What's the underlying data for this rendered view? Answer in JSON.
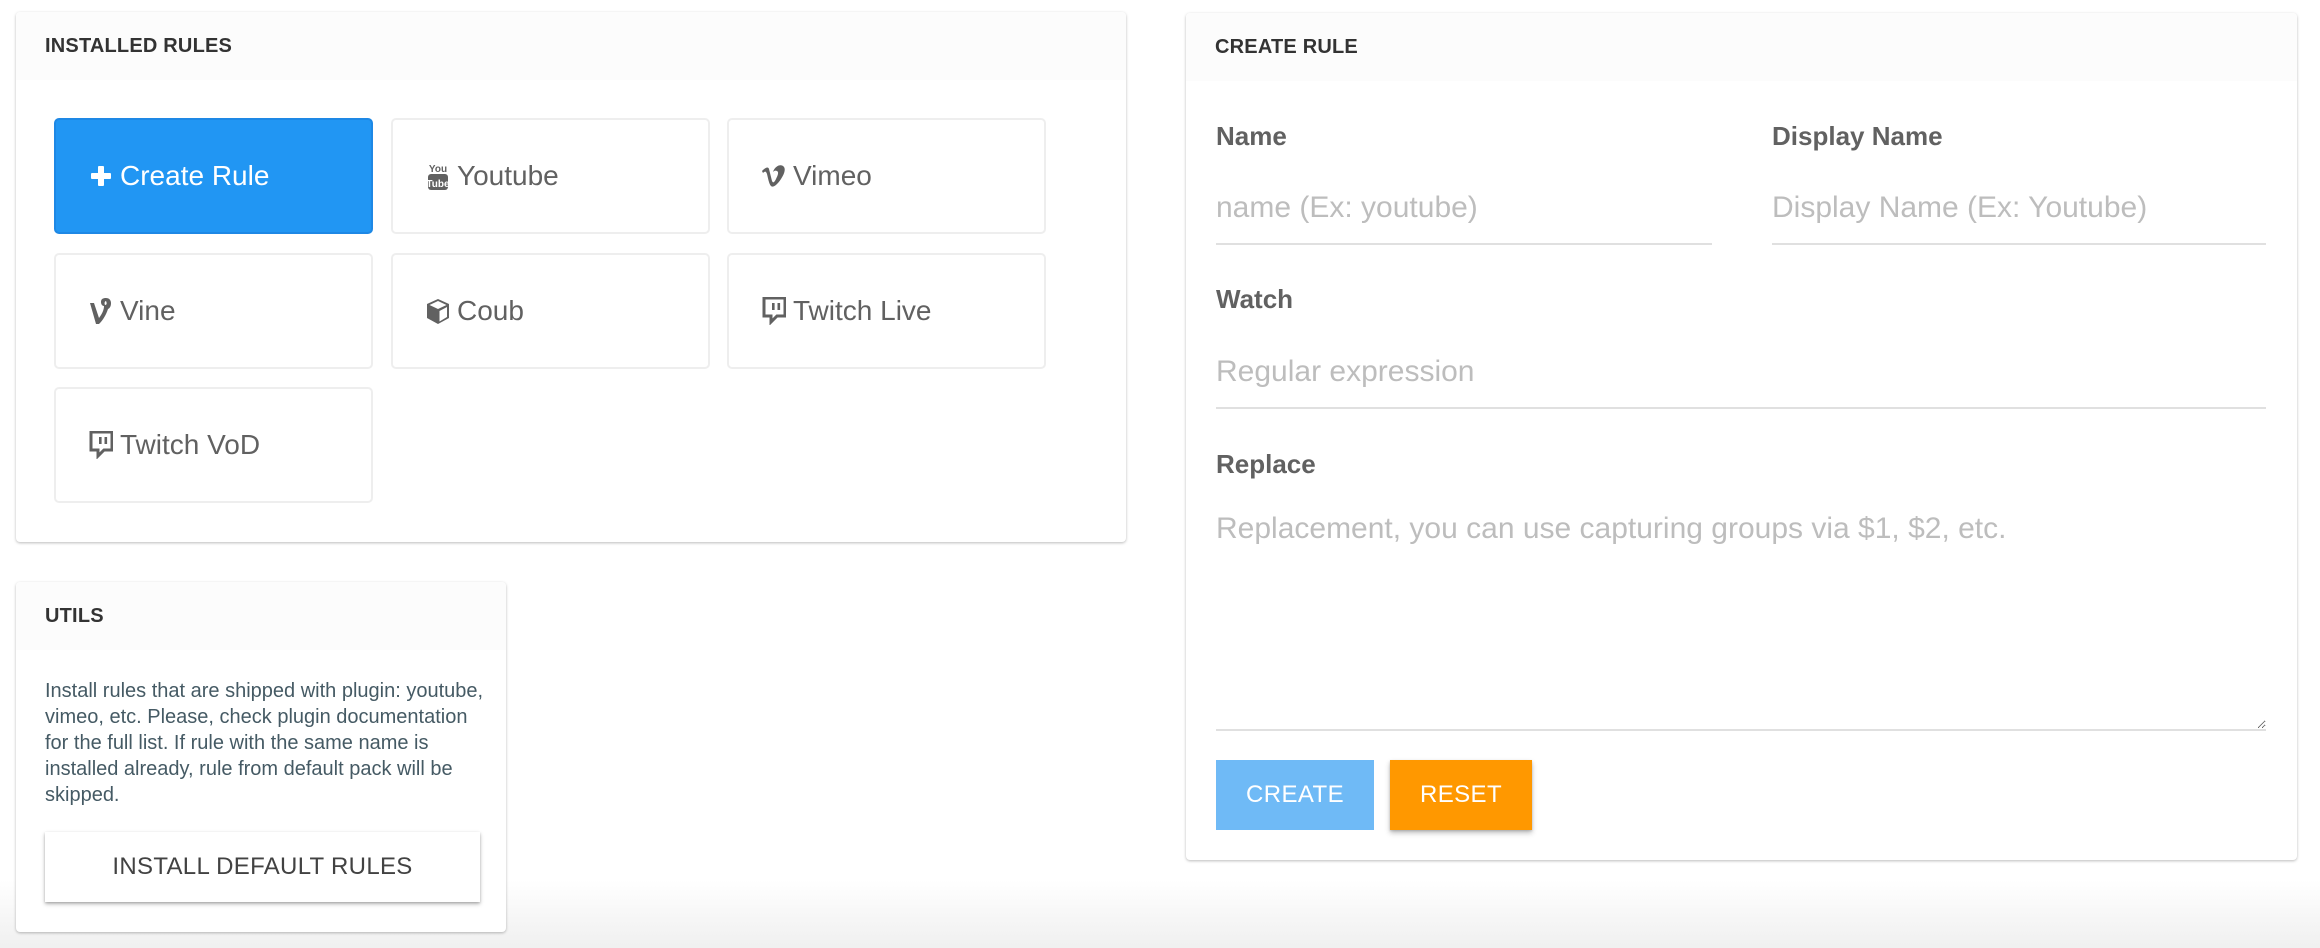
{
  "installed_rules": {
    "title": "INSTALLED RULES",
    "tiles": [
      {
        "label": "Create Rule",
        "icon": "plus-icon",
        "primary": true
      },
      {
        "label": "Youtube",
        "icon": "youtube-icon"
      },
      {
        "label": "Vimeo",
        "icon": "vimeo-icon"
      },
      {
        "label": "Vine",
        "icon": "vine-icon"
      },
      {
        "label": "Coub",
        "icon": "coub-cube-icon"
      },
      {
        "label": "Twitch Live",
        "icon": "twitch-icon"
      },
      {
        "label": "Twitch VoD",
        "icon": "twitch-icon"
      }
    ]
  },
  "utils": {
    "title": "UTILS",
    "description": "Install rules that are shipped with plugin: youtube, vimeo, etc. Please, check plugin documentation for the full list. If rule with the same name is installed already, rule from default pack will be skipped.",
    "install_button": "INSTALL DEFAULT RULES"
  },
  "create_rule": {
    "title": "CREATE RULE",
    "name": {
      "label": "Name",
      "value": "",
      "placeholder": "name (Ex: youtube)"
    },
    "display_name": {
      "label": "Display Name",
      "value": "",
      "placeholder": "Display Name (Ex: Youtube)"
    },
    "watch": {
      "label": "Watch",
      "value": "",
      "placeholder": "Regular expression"
    },
    "replace": {
      "label": "Replace",
      "value": "",
      "placeholder": "Replacement, you can use capturing groups via $1, $2, etc."
    },
    "create_button": "CREATE",
    "reset_button": "RESET"
  },
  "colors": {
    "primary": "#2196f3",
    "create_disabled": "#6fbaf6",
    "reset": "#ff9800",
    "icon_gray": "#616161"
  }
}
